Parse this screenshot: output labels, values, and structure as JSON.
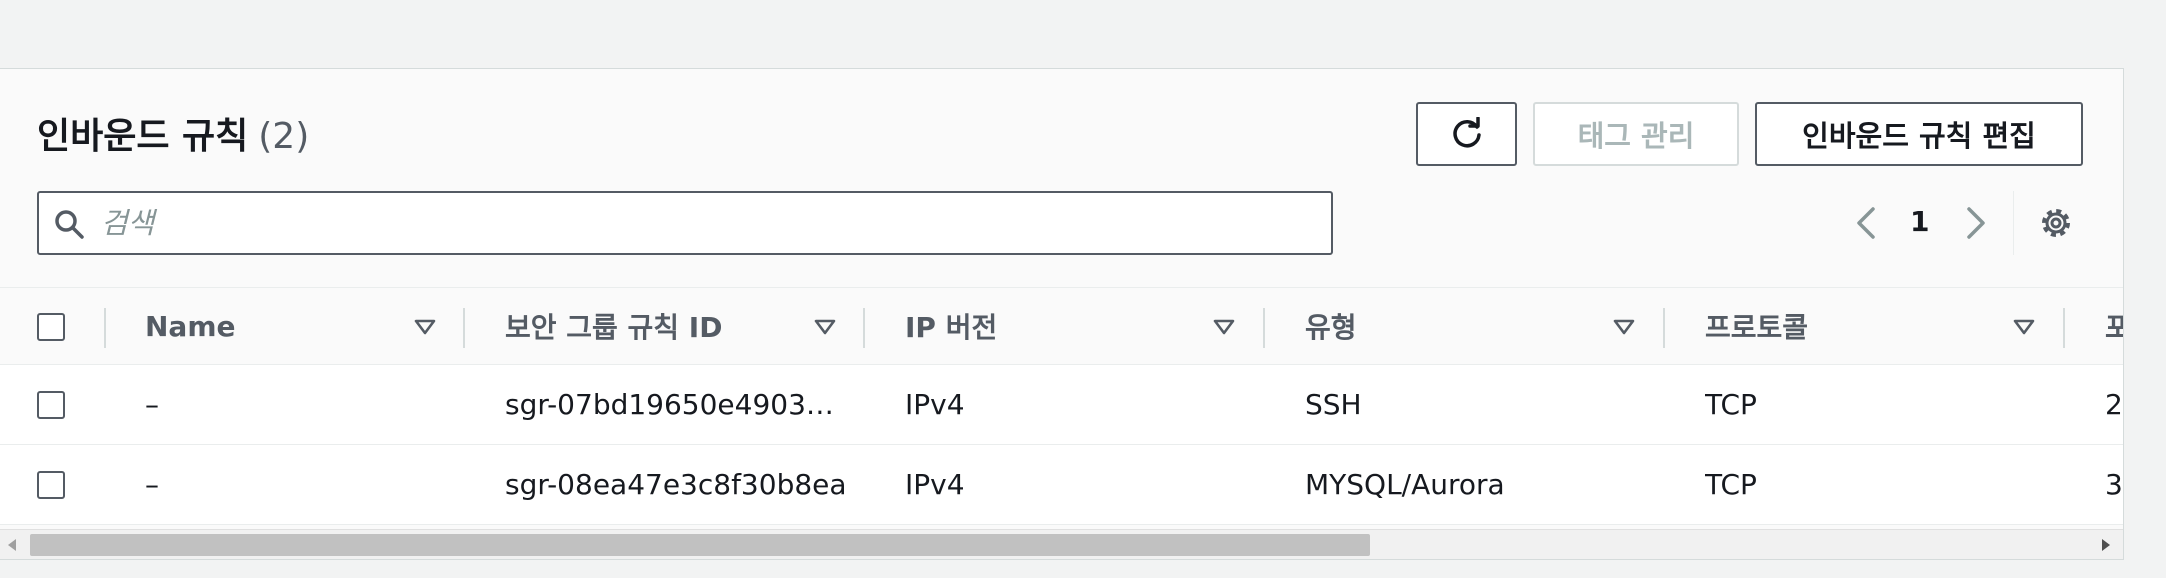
{
  "header": {
    "title": "인바운드 규칙",
    "count": "(2)"
  },
  "toolbar": {
    "manage_tags_label": "태그 관리",
    "edit_inbound_label": "인바운드 규칙 편집"
  },
  "search": {
    "placeholder": "검색",
    "value": ""
  },
  "pagination": {
    "current_page": "1"
  },
  "columns": [
    "Name",
    "보안 그룹 규칙 ID",
    "IP 버전",
    "유형",
    "프로토콜",
    "포"
  ],
  "rows": [
    {
      "name": "–",
      "rule_id": "sgr-07bd19650e4903…",
      "ip_version": "IPv4",
      "type": "SSH",
      "protocol": "TCP",
      "port": "2"
    },
    {
      "name": "–",
      "rule_id": "sgr-08ea47e3c8f30b8ea",
      "ip_version": "IPv4",
      "type": "MYSQL/Aurora",
      "protocol": "TCP",
      "port": "3"
    }
  ],
  "icons": {
    "refresh": "refresh-icon",
    "search": "search-icon",
    "prev": "chevron-left-icon",
    "next": "chevron-right-icon",
    "settings": "gear-icon",
    "sort": "sort-caret-icon"
  },
  "colors": {
    "border_dark": "#545b64",
    "text": "#16191f",
    "disabled": "#aab7b8"
  }
}
